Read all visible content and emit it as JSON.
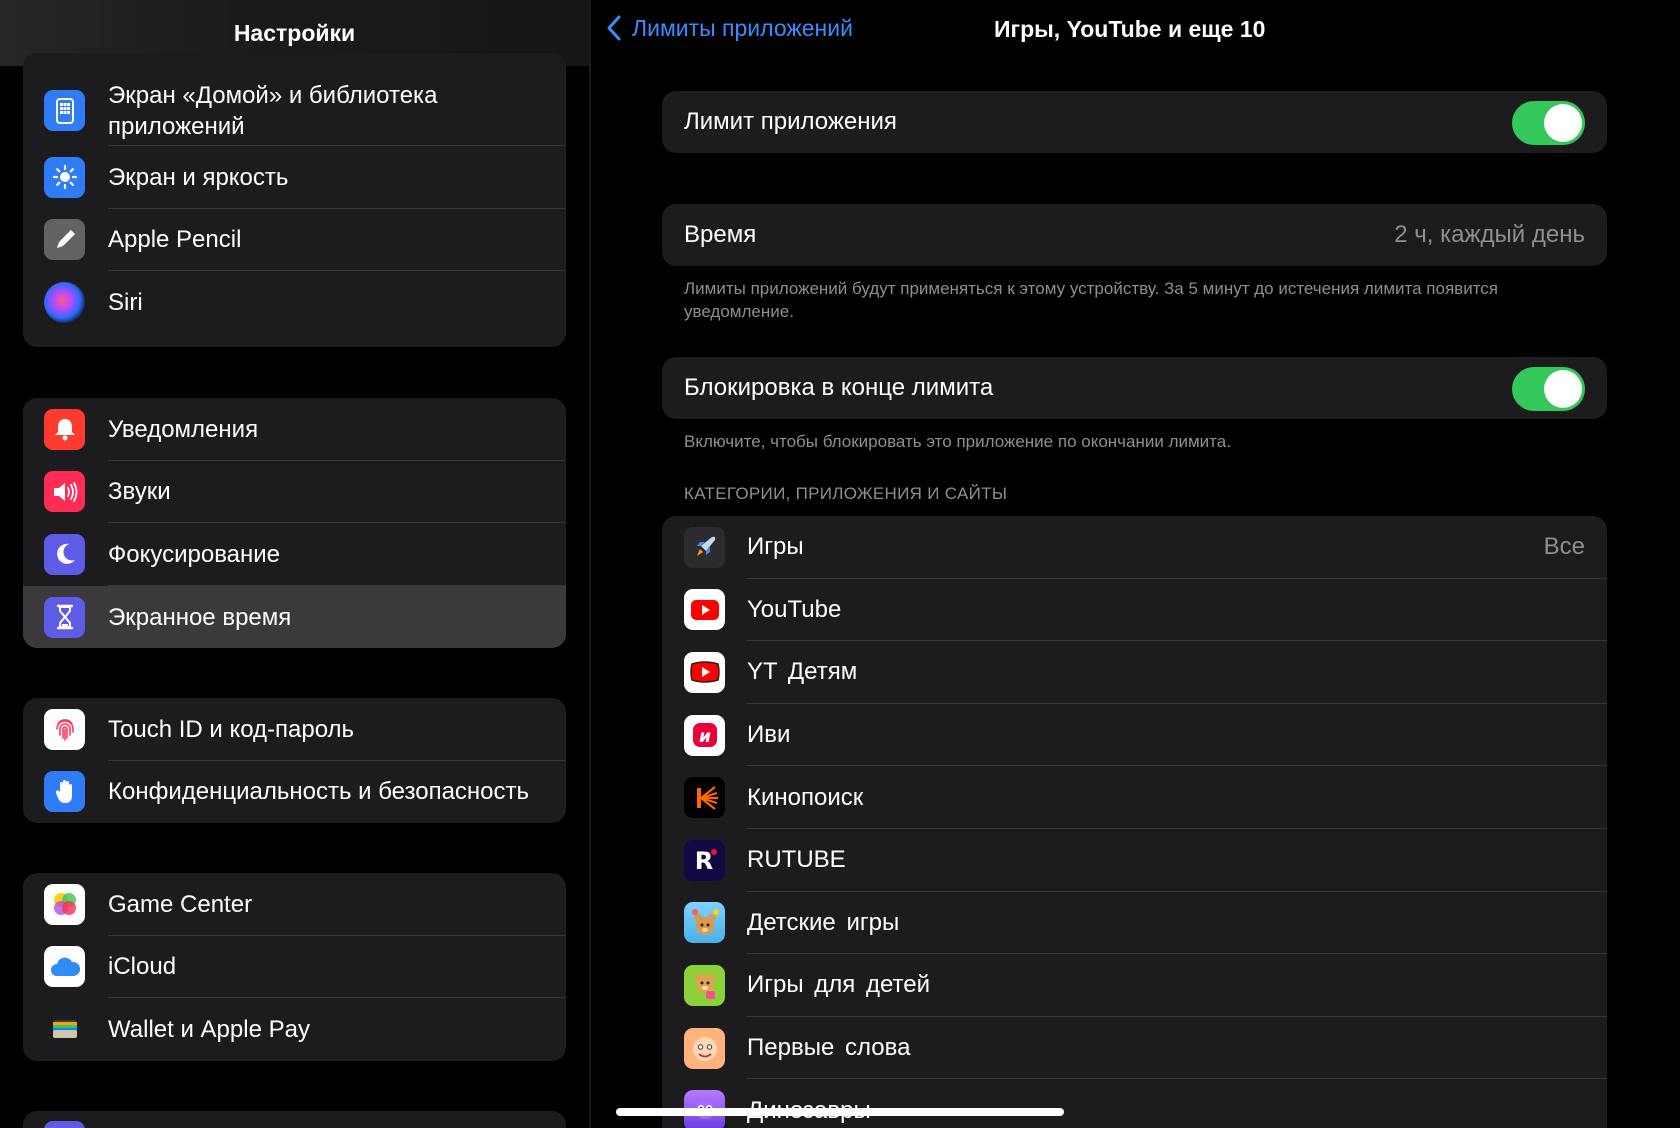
{
  "sidebar": {
    "title": "Настройки",
    "groups": [
      {
        "items": [
          {
            "label": "Экран «Домой» и библиотека приложений",
            "icon": "home-screen-icon",
            "color": "#2f7cf6"
          },
          {
            "label": "Экран и яркость",
            "icon": "sun-icon",
            "color": "#2f7cf6"
          },
          {
            "label": "Apple Pencil",
            "icon": "pencil-icon",
            "color": "#636366"
          },
          {
            "label": "Siri",
            "icon": "siri-icon",
            "color": "#1a1a2e"
          }
        ]
      },
      {
        "items": [
          {
            "label": "Уведомления",
            "icon": "bell-icon",
            "color": "#ff3b30"
          },
          {
            "label": "Звуки",
            "icon": "speaker-icon",
            "color": "#ff2d55"
          },
          {
            "label": "Фокусирование",
            "icon": "moon-icon",
            "color": "#5e5ce6"
          },
          {
            "label": "Экранное время",
            "icon": "hourglass-icon",
            "color": "#5e5ce6",
            "selected": true
          }
        ]
      },
      {
        "items": [
          {
            "label": "Touch ID и код-пароль",
            "icon": "fingerprint-icon",
            "color": "#ffffff"
          },
          {
            "label": "Конфиденциальность и безопасность",
            "icon": "hand-icon",
            "color": "#2f7cf6"
          }
        ]
      },
      {
        "items": [
          {
            "label": "Game Center",
            "icon": "game-center-icon",
            "color": "#ffffff"
          },
          {
            "label": "iCloud",
            "icon": "cloud-icon",
            "color": "#ffffff"
          },
          {
            "label": "Wallet и Apple Pay",
            "icon": "wallet-icon",
            "color": "#1c1c1e"
          }
        ]
      }
    ]
  },
  "detail": {
    "back_label": "Лимиты приложений",
    "title": "Игры, YouTube и еще 10",
    "app_limit": {
      "label": "Лимит приложения",
      "enabled": true
    },
    "time": {
      "label": "Время",
      "value": "2 ч, каждый день"
    },
    "time_footnote": "Лимиты приложений будут применяться к этому устройству. За 5 минут до истечения лимита появится уведомление.",
    "block": {
      "label": "Блокировка в конце лимита",
      "enabled": true
    },
    "block_footnote": "Включите, чтобы блокировать это приложение по окончании лимита.",
    "section_header": "КАТЕГОРИИ, ПРИЛОЖЕНИЯ И САЙТЫ",
    "apps": [
      {
        "label": "Игры",
        "value": "Все",
        "icon": "rocket-icon"
      },
      {
        "label": "YouTube",
        "icon": "youtube-icon"
      },
      {
        "label": "YT Детям",
        "icon": "youtube-kids-icon"
      },
      {
        "label": "Иви",
        "icon": "ivi-icon"
      },
      {
        "label": "Кинопоиск",
        "icon": "kinopoisk-icon"
      },
      {
        "label": "RUTUBE",
        "icon": "rutube-icon"
      },
      {
        "label": "Детские игры",
        "icon": "kids-games-icon"
      },
      {
        "label": "Игры для детей",
        "icon": "games-for-kids-icon"
      },
      {
        "label": "Первые слова",
        "icon": "first-words-icon"
      },
      {
        "label": "Динозавры",
        "icon": "dinosaurs-icon"
      }
    ]
  },
  "colors": {
    "accent": "#3a8cff",
    "toggle_on": "#34c759"
  }
}
